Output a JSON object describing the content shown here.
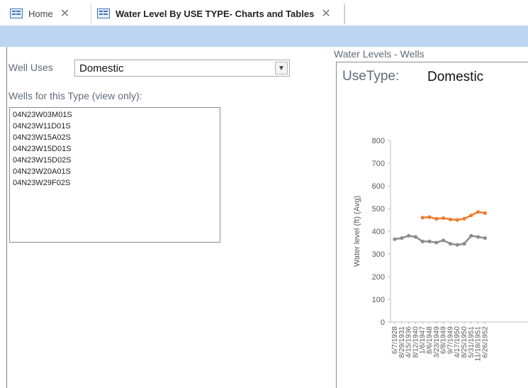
{
  "tabs": [
    {
      "label": "Home",
      "icon": "form-icon"
    },
    {
      "label": "Water Level By USE TYPE- Charts and Tables",
      "icon": "form-icon"
    }
  ],
  "form": {
    "well_uses_label": "Well Uses",
    "well_uses_value": "Domestic",
    "wells_list_label": "Wells for this Type (view only):",
    "wells": [
      "04N23W03M01S",
      "04N23W11D01S",
      "04N23W15A02S",
      "04N23W15D01S",
      "04N23W15D02S",
      "04N23W20A01S",
      "04N23W29F02S"
    ]
  },
  "chart": {
    "caption": "Water Levels - Wells",
    "usetype_label": "UseType:",
    "usetype_value": "Domestic",
    "series_colors": [
      "#ed7d31",
      "#8c8c8c"
    ]
  },
  "chart_data": {
    "type": "line",
    "ylabel": "Water level (ft) (Avg)",
    "ylim": [
      0,
      800
    ],
    "yticks": [
      0,
      100,
      200,
      300,
      400,
      500,
      600,
      700,
      800
    ],
    "categories": [
      "6/7/1928",
      "8/29/1931",
      "4/15/1936",
      "8/12/1940",
      "1/6/1947",
      "8/6/1948",
      "3/23/1949",
      "6/8/1949",
      "9/7/1949",
      "4/17/1950",
      "8/25/1950",
      "5/31/1951",
      "11/18/1951",
      "6/26/1952"
    ],
    "series": [
      {
        "values": [
          null,
          null,
          null,
          null,
          460,
          462,
          455,
          458,
          452,
          450,
          455,
          470,
          485,
          480
        ]
      },
      {
        "values": [
          365,
          370,
          380,
          375,
          355,
          355,
          350,
          360,
          345,
          340,
          345,
          380,
          375,
          370
        ]
      }
    ]
  }
}
